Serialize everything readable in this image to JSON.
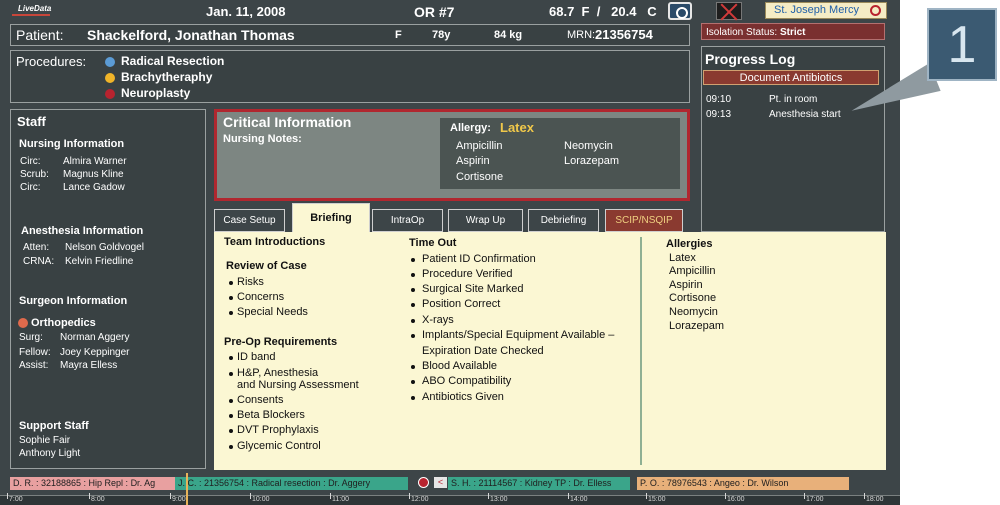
{
  "header": {
    "logo": "LiveData",
    "date": "Jan. 11, 2008",
    "room": "OR #7",
    "temperature": "68.7  F  /   20.4   C",
    "hospital": "St. Joseph Mercy"
  },
  "patient": {
    "label": "Patient:",
    "name": "Shackelford, Jonathan Thomas",
    "sex": "F",
    "age": "78y",
    "weight": "84 kg",
    "mrn_label": "MRN:",
    "mrn": "21356754"
  },
  "procedures": {
    "label": "Procedures:",
    "items": [
      {
        "name": "Radical Resection",
        "color": "#5b9bd5"
      },
      {
        "name": "Brachytheraphy",
        "color": "#f0b429"
      },
      {
        "name": "Neuroplasty",
        "color": "#b8232f"
      }
    ]
  },
  "staff": {
    "title": "Staff",
    "nursing": {
      "title": "Nursing Information",
      "rows": [
        {
          "role": "Circ:",
          "name": "Almira Warner"
        },
        {
          "role": "Scrub:",
          "name": "Magnus Kline"
        },
        {
          "role": "Circ:",
          "name": "Lance Gadow"
        }
      ]
    },
    "anesthesia": {
      "title": "Anesthesia Information",
      "rows": [
        {
          "role": "Atten:",
          "name": "Nelson Goldvogel"
        },
        {
          "role": "CRNA:",
          "name": "Kelvin Friedline"
        }
      ]
    },
    "surgeon": {
      "title": "Surgeon Information",
      "specialty": "Orthopedics",
      "specialty_color": "#e06a4c",
      "rows": [
        {
          "role": "Surg:",
          "name": "Norman Aggery"
        },
        {
          "role": "Fellow:",
          "name": "Joey Keppinger"
        },
        {
          "role": "Assist:",
          "name": "Mayra Elless"
        }
      ]
    },
    "support": {
      "title": "Support Staff",
      "names": [
        "Sophie Fair",
        "Anthony Light"
      ]
    }
  },
  "critical": {
    "title": "Critical Information",
    "subtitle": "Nursing Notes:",
    "allergy_label": "Allergy:",
    "allergy_main": "Latex",
    "allergy_items": [
      "Ampicillin",
      "Neomycin",
      "Aspirin",
      "Lorazepam",
      "Cortisone"
    ]
  },
  "isolation": {
    "label": "Isolation Status:",
    "value": "Strict"
  },
  "progress": {
    "title": "Progress Log",
    "button": "Document  Antibiotics",
    "entries": [
      {
        "time": "09:10",
        "text": "Pt. in room"
      },
      {
        "time": "09:13",
        "text": "Anesthesia start"
      }
    ]
  },
  "callout": "1",
  "tabs": [
    {
      "label": "Case Setup",
      "active": false
    },
    {
      "label": "Briefing",
      "active": true
    },
    {
      "label": "IntraOp",
      "active": false
    },
    {
      "label": "Wrap Up",
      "active": false
    },
    {
      "label": "Debriefing",
      "active": false
    },
    {
      "label": "SCIP/NSQIP",
      "active": false
    }
  ],
  "briefing": {
    "team_intro": "Team Introductions",
    "review_title": "Review of Case",
    "review_items": [
      "Risks",
      "Concerns",
      "Special Needs"
    ],
    "preop_title": "Pre-Op Requirements",
    "preop_items": [
      "ID band",
      "H&P, Anesthesia",
      "and Nursing Assessment",
      "Consents",
      "Beta Blockers",
      "DVT Prophylaxis",
      "Glycemic Control"
    ],
    "timeout_title": "Time Out",
    "timeout_items": [
      "Patient ID Confirmation",
      "Procedure Verified",
      "Surgical Site Marked",
      "Position Correct",
      "X-rays",
      "Implants/Special Equipment Available –",
      "Expiration Date Checked",
      "Blood Available",
      "ABO Compatibility",
      "Antibiotics Given"
    ],
    "allergies_title": "Allergies",
    "allergies": [
      "Latex",
      "Ampicillin",
      "Aspirin",
      "Cortisone",
      "Neomycin",
      "Lorazepam"
    ]
  },
  "timeline": {
    "cases": [
      {
        "text": "D. R. : 32188865 : Hip Repl : Dr. Ag",
        "color": "#e8a0a0"
      },
      {
        "text": "J. C. : 21356754 : Radical resection : Dr. Aggery",
        "color": "#3aa58a"
      },
      {
        "text": "S. H. : 21114567 : Kidney TP : Dr. Elless",
        "color": "#3aa58a"
      },
      {
        "text": "P. O. : 78976543 : Angeo : Dr. Wilson",
        "color": "#e8b07a"
      }
    ],
    "hours": [
      "7:00",
      "8:00",
      "9:00",
      "10:00",
      "11:00",
      "12:00",
      "13:00",
      "14:00",
      "15:00",
      "16:00",
      "17:00",
      "18:00"
    ]
  }
}
